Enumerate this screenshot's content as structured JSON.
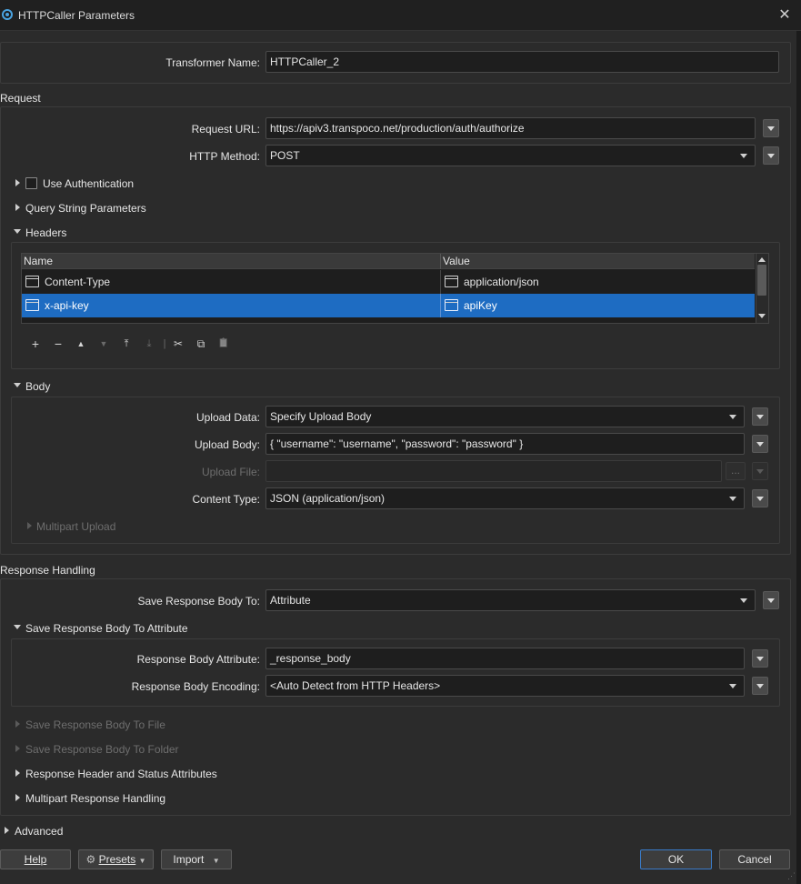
{
  "window": {
    "title": "HTTPCaller Parameters",
    "close_glyph": "✕"
  },
  "transformer": {
    "label": "Transformer Name:",
    "value": "HTTPCaller_2"
  },
  "request": {
    "section_label": "Request",
    "url_label": "Request URL:",
    "url_value": "https://apiv3.transpoco.net/production/auth/authorize",
    "method_label": "HTTP Method:",
    "method_value": "POST",
    "use_auth_label": "Use Authentication",
    "query_label": "Query String Parameters",
    "headers_label": "Headers"
  },
  "headers_table": {
    "columns": [
      "Name",
      "Value"
    ],
    "rows": [
      {
        "name": "Content-Type",
        "value": "application/json",
        "selected": false
      },
      {
        "name": "x-api-key",
        "value": "apiKey",
        "selected": true
      }
    ],
    "toolbar": [
      "+",
      "−",
      "▲",
      "▼",
      "⤒",
      "⤓",
      "|",
      "✂",
      "⧉",
      "📋"
    ]
  },
  "body": {
    "section_label": "Body",
    "upload_data_label": "Upload Data:",
    "upload_data_value": "Specify Upload Body",
    "upload_body_label": "Upload Body:",
    "upload_body_value": "{ \"username\": \"username\", \"password\": \"password\" }",
    "upload_file_label": "Upload File:",
    "upload_file_browse": "...",
    "content_type_label": "Content Type:",
    "content_type_value": "JSON (application/json)",
    "multipart_label": "Multipart Upload"
  },
  "response": {
    "section_label": "Response Handling",
    "save_to_label": "Save Response Body To:",
    "save_to_value": "Attribute",
    "save_attr_section": "Save Response Body To Attribute",
    "body_attr_label": "Response Body Attribute:",
    "body_attr_value": "_response_body",
    "encoding_label": "Response Body Encoding:",
    "encoding_value": "<Auto Detect from HTTP Headers>",
    "save_file_section": "Save Response Body To File",
    "save_folder_section": "Save Response Body To Folder",
    "header_status_section": "Response Header and Status Attributes",
    "multipart_section": "Multipart Response Handling"
  },
  "advanced": {
    "label": "Advanced"
  },
  "footer": {
    "help": "Help",
    "presets": "Presets",
    "import": "Import",
    "ok": "OK",
    "cancel": "Cancel"
  },
  "colors": {
    "background": "#2b2b2b",
    "selection": "#1e6cc2",
    "field": "#1e1e1e",
    "ok_border": "#3a7bc8"
  },
  "icons": [
    "radio-app-icon",
    "close-icon",
    "disclosure-triangle-icon",
    "checkbox-icon",
    "cell-attribute-icon",
    "dropdown-arrow-icon",
    "gear-icon"
  ]
}
